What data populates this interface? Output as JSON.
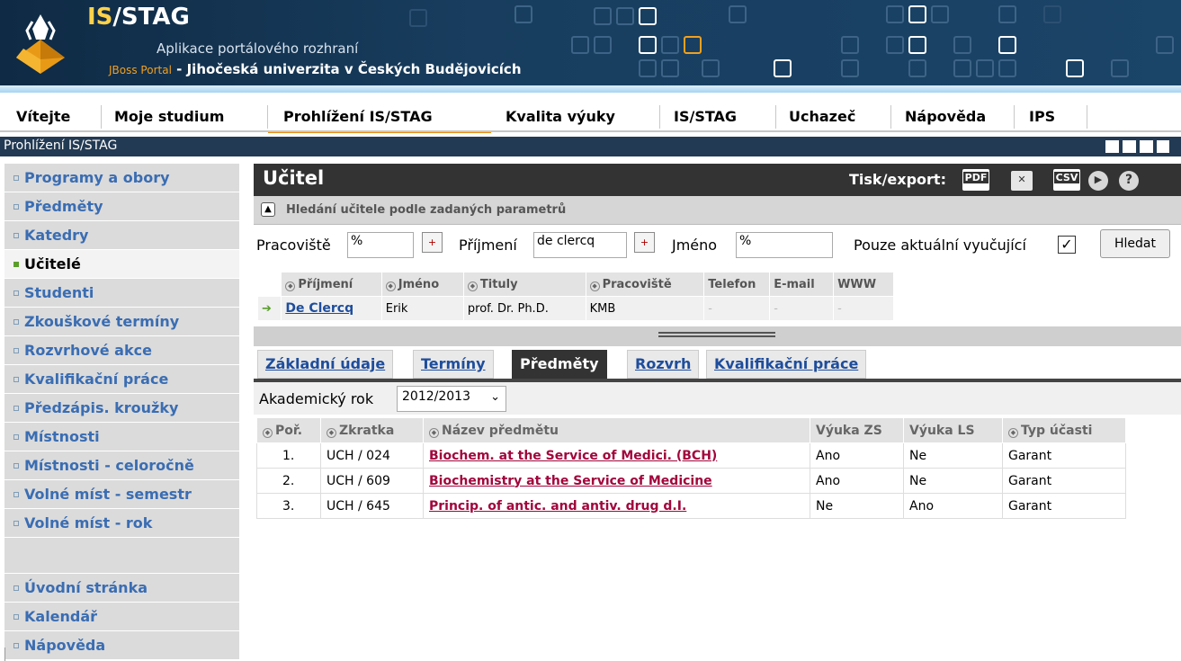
{
  "header": {
    "brand": "IS/STAG",
    "brand_prefix": "IS",
    "brand_suffix": "/STAG",
    "subtitle": "Aplikace portálového rozhraní",
    "portal_label": "JBoss Portal",
    "portal_text": " - Jihočeská univerzita v Českých Budějovicích"
  },
  "tabs": [
    {
      "label": "Vítejte"
    },
    {
      "label": "Moje studium"
    },
    {
      "label": "Prohlížení IS/STAG",
      "active": true
    },
    {
      "label": "Kvalita výuky"
    },
    {
      "label": "IS/STAG"
    },
    {
      "label": "Uchazeč"
    },
    {
      "label": "Nápověda"
    },
    {
      "label": "IPS"
    }
  ],
  "portlet": {
    "title": "Prohlížení IS/STAG"
  },
  "sidebar": {
    "items": [
      {
        "label": "Programy a obory"
      },
      {
        "label": "Předměty"
      },
      {
        "label": "Katedry"
      },
      {
        "label": "Učitelé",
        "active": true
      },
      {
        "label": "Studenti"
      },
      {
        "label": "Zkouškové termíny"
      },
      {
        "label": "Rozvrhové akce"
      },
      {
        "label": "Kvalifikační práce"
      },
      {
        "label": "Předzápis. kroužky"
      },
      {
        "label": "Místnosti"
      },
      {
        "label": "Místnosti - celoročně"
      },
      {
        "label": "Volné míst - semestr"
      },
      {
        "label": "Volné míst - rok"
      }
    ],
    "bottom_items": [
      {
        "label": "Úvodní stránka"
      },
      {
        "label": "Kalendář"
      },
      {
        "label": "Nápověda"
      }
    ]
  },
  "main": {
    "title": "Učitel",
    "export_label": "Tisk/export:",
    "export_icons": [
      "pdf-icon",
      "excel-icon",
      "csv-icon",
      "more-icon",
      "help-icon"
    ],
    "export_pdf": "PDF",
    "export_csv": "CSV",
    "help": "?",
    "search_header": "Hledání učitele podle zadaných parametrů",
    "search": {
      "pracoviste_label": "Pracoviště",
      "pracoviste_value": "%",
      "prijmeni_label": "Příjmení",
      "prijmeni_value": "de clercq",
      "jmeno_label": "Jméno",
      "jmeno_value": "%",
      "aktualni_label": "Pouze aktuální vyučující",
      "aktualni_checked": true,
      "hledat_label": "Hledat"
    },
    "results": {
      "columns": [
        "Příjmení",
        "Jméno",
        "Tituly",
        "Pracoviště",
        "Telefon",
        "E-mail",
        "WWW"
      ],
      "rows": [
        {
          "prijmeni": "De Clercq",
          "jmeno": "Erik",
          "tituly": "prof. Dr. Ph.D.",
          "pracoviste": "KMB",
          "telefon": "-",
          "email": "-",
          "www": "-"
        }
      ]
    },
    "subtabs": [
      {
        "label": "Základní údaje"
      },
      {
        "label": "Termíny"
      },
      {
        "label": "Předměty",
        "active": true
      },
      {
        "label": "Rozvrh"
      },
      {
        "label": "Kvalifikační práce"
      }
    ],
    "year_label": "Akademický rok",
    "year_value": "2012/2013",
    "courses": {
      "columns": [
        "Poř.",
        "Zkratka",
        "Název předmětu",
        "Výuka ZS",
        "Výuka LS",
        "Typ účasti"
      ],
      "rows": [
        {
          "por": "1.",
          "zkratka": "UCH / 024",
          "nazev": "Biochem. at the Service of Medici. (BCH)",
          "zs": "Ano",
          "ls": "Ne",
          "typ": "Garant"
        },
        {
          "por": "2.",
          "zkratka": "UCH / 609",
          "nazev": "Biochemistry at the Service of Medicine",
          "zs": "Ano",
          "ls": "Ne",
          "typ": "Garant"
        },
        {
          "por": "3.",
          "zkratka": "UCH / 645",
          "nazev": "Princip. of antic. and antiv. drug d.I.",
          "zs": "Ne",
          "ls": "Ano",
          "typ": "Garant"
        }
      ]
    }
  },
  "colors": {
    "header_bg": "#183d5e",
    "brand_yellow": "#ffd24a",
    "active_tab_underline": "#f08c00",
    "link_blue": "#3a6db3",
    "course_link": "#a1063c",
    "title_bar": "#333333"
  }
}
